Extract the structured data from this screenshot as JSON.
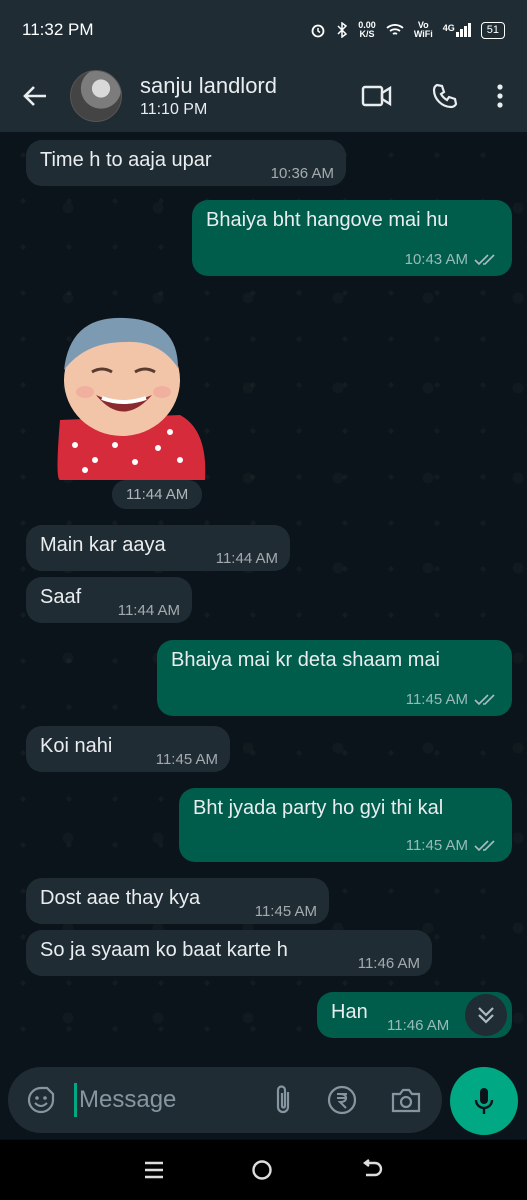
{
  "status_bar": {
    "time": "11:32 PM",
    "net_speed_value": "0.00",
    "net_speed_unit": "K/S",
    "vowifi_top": "Vo",
    "vowifi_bottom": "WiFi",
    "network": "4G",
    "battery": "51",
    "icons": [
      "alarm-icon",
      "bluetooth-icon",
      "wifi-icon",
      "signal-icon",
      "battery-icon"
    ]
  },
  "header": {
    "contact_name": "sanju landlord",
    "contact_status": "11:10 PM",
    "icons": [
      "back-arrow-icon",
      "video-call-icon",
      "voice-call-icon",
      "more-options-icon"
    ]
  },
  "messages": [
    {
      "direction": "incoming",
      "text": "Time h to aaja upar",
      "time": "10:36 AM"
    },
    {
      "direction": "outgoing",
      "text": "Bhaiya bht hangove mai hu",
      "time": "10:43 AM",
      "read": true
    },
    {
      "direction": "incoming",
      "type": "sticker",
      "time": "11:44 AM"
    },
    {
      "direction": "incoming",
      "text": "Main kar aaya",
      "time": "11:44 AM"
    },
    {
      "direction": "incoming",
      "text": "Saaf",
      "time": "11:44 AM"
    },
    {
      "direction": "outgoing",
      "text": "Bhaiya mai kr deta shaam mai",
      "time": "11:45 AM",
      "read": true
    },
    {
      "direction": "incoming",
      "text": "Koi nahi",
      "time": "11:45 AM"
    },
    {
      "direction": "outgoing",
      "text": "Bht jyada party ho gyi thi kal",
      "time": "11:45 AM",
      "read": true
    },
    {
      "direction": "incoming",
      "text": "Dost aae thay kya",
      "time": "11:45 AM"
    },
    {
      "direction": "incoming",
      "text": "So ja syaam ko baat karte h",
      "time": "11:46 AM"
    },
    {
      "direction": "outgoing",
      "text": "Han",
      "time": "11:46 AM"
    }
  ],
  "composer": {
    "placeholder": "Message",
    "icons": [
      "emoji-icon",
      "attach-icon",
      "rupee-payment-icon",
      "camera-icon",
      "microphone-icon"
    ]
  },
  "colors": {
    "header_bg": "#1f2c34",
    "chat_bg": "#0b141a",
    "incoming_bubble": "#202c33",
    "outgoing_bubble": "#005c4b",
    "accent": "#00a884"
  }
}
